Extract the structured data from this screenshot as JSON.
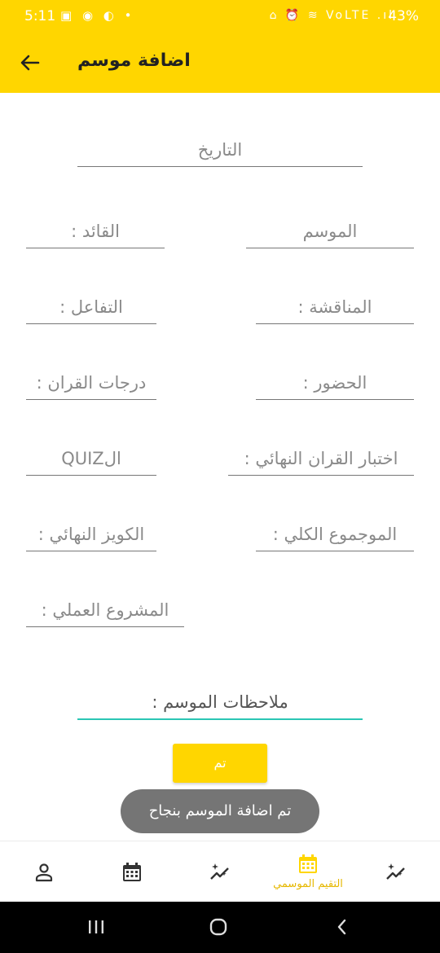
{
  "status_bar": {
    "time": "5:11",
    "left_icons": "▣ ◉ ◐ •",
    "right_icons": "⌂ ⏰ ≋ VoLTE .ıl",
    "battery": "43%"
  },
  "app_bar": {
    "title": "اضافة موسم",
    "back_icon": "arrow-back-icon"
  },
  "form": {
    "date": "التاريخ",
    "season": "الموسم",
    "leader": "القائد :",
    "discussion": "المناقشة :",
    "interaction": "التفاعل :",
    "attendance": "الحضور :",
    "quran_grades": "درجات القران :",
    "final_quran_test": "اختبار القران النهائي :",
    "quiz": "الQUIZ",
    "total": "الموجموع الكلي :",
    "final_quiz": "الكويز النهائي :",
    "practical_project": "المشروع العملي :",
    "season_notes": "ملاحظات الموسم :"
  },
  "done_button": "تم",
  "toast": "تم اضافة الموسم بنجاح",
  "bottom_nav": {
    "items": [
      {
        "icon": "person-icon",
        "label": ""
      },
      {
        "icon": "calendar-icon",
        "label": ""
      },
      {
        "icon": "sparkle-chart-icon",
        "label": ""
      },
      {
        "icon": "calendar-icon",
        "label": "التقيم الموسمي"
      },
      {
        "icon": "sparkle-chart-icon",
        "label": ""
      }
    ]
  },
  "colors": {
    "accent": "#FFD600",
    "active_field": "#2BC6B4",
    "active_nav_label": "#E6B800",
    "toast_bg": "#757575"
  }
}
